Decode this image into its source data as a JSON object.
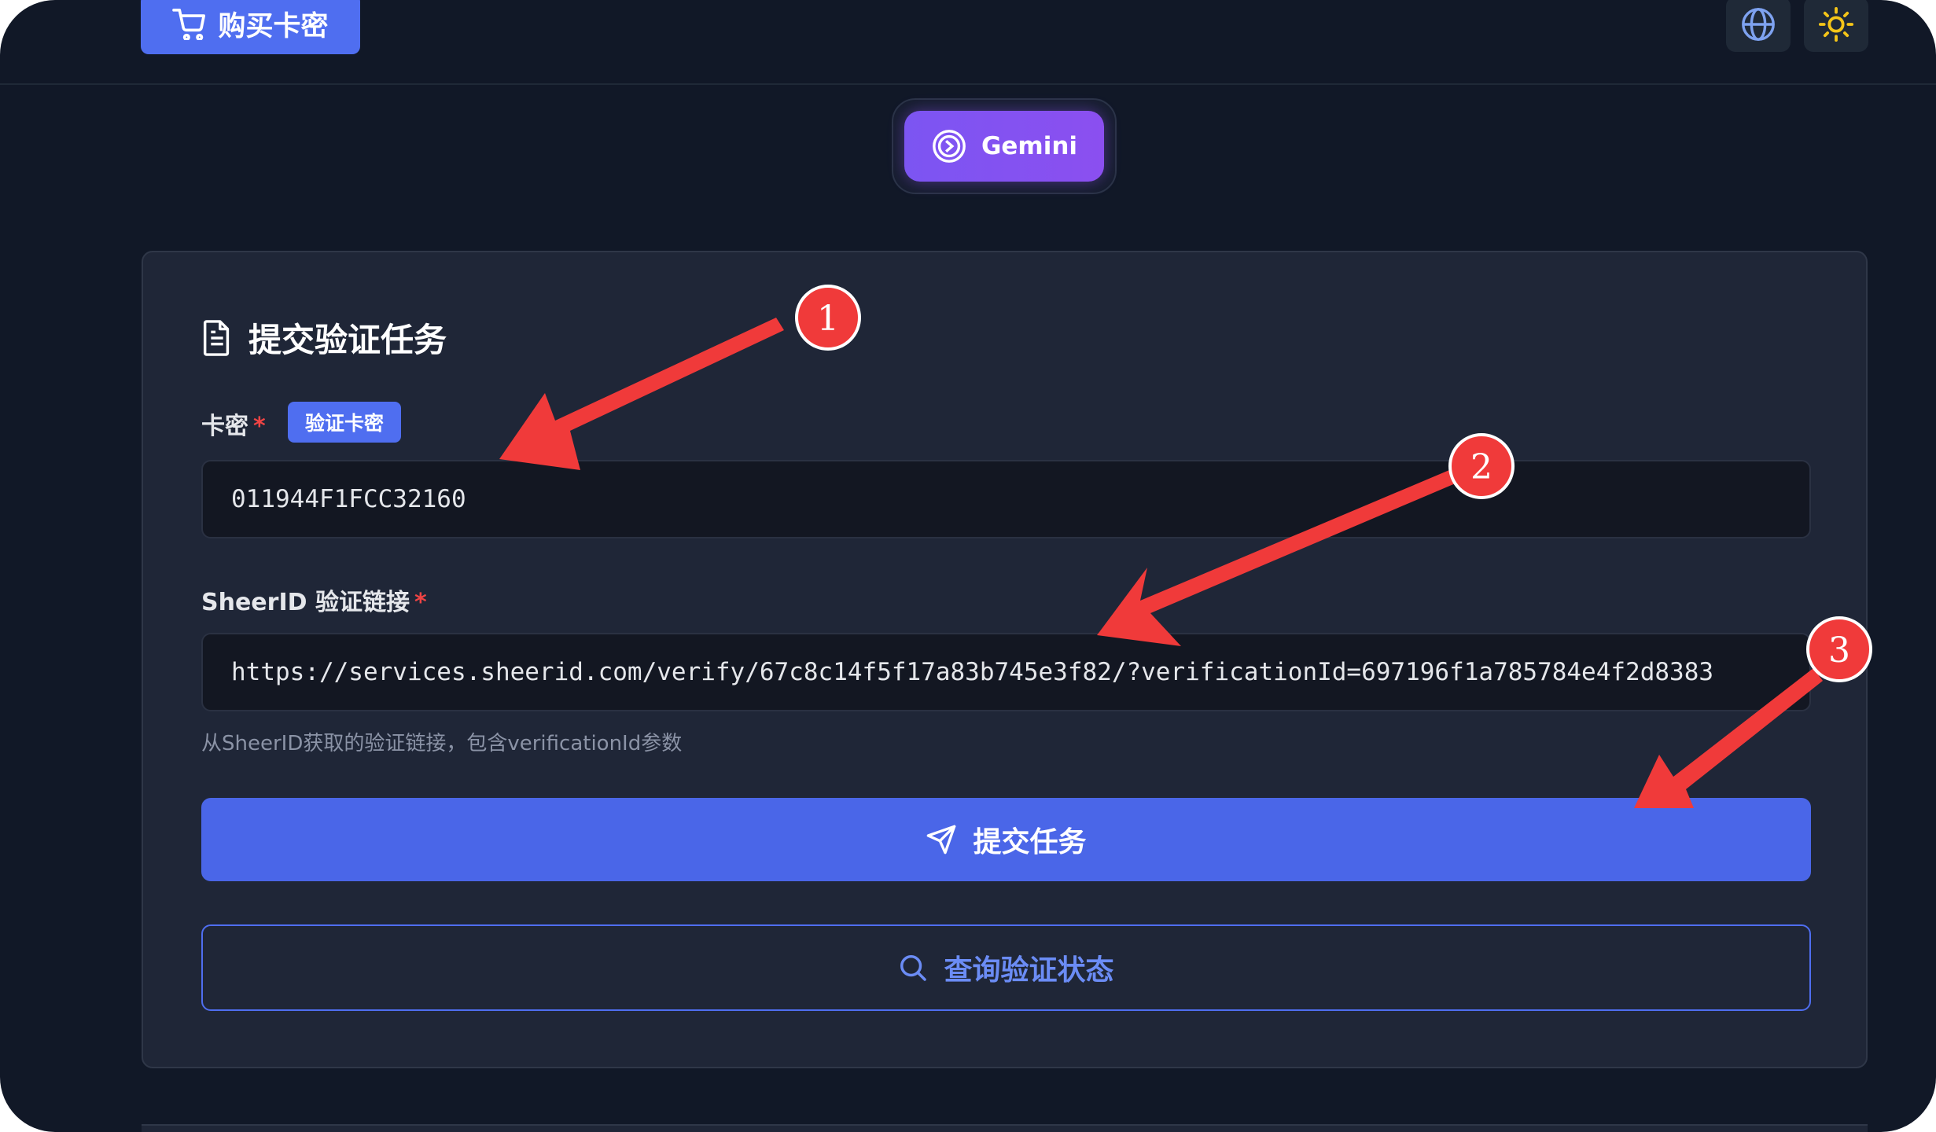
{
  "topbar": {
    "buy_button_label": "购买卡密",
    "language_icon": "globe-icon",
    "theme_icon": "sun-icon"
  },
  "tabs": {
    "active_label": "Gemini"
  },
  "form": {
    "title": "提交验证任务",
    "card_key_label": "卡密",
    "verify_card_badge": "验证卡密",
    "card_key_value": "011944F1FCC32160",
    "sheerid_label": "SheerID 验证链接",
    "sheerid_value": "https://services.sheerid.com/verify/67c8c14f5f17a83b745e3f82/?verificationId=697196f1a785784e4f2d8383",
    "sheerid_hint": "从SheerID获取的验证链接，包含verificationId参数",
    "required_mark": "*",
    "submit_label": "提交任务",
    "query_label": "查询验证状态"
  },
  "annotations": {
    "markers": [
      "1",
      "2",
      "3"
    ]
  },
  "colors": {
    "accent": "#4f6ef0",
    "gemini": "#7c55f2",
    "annotation_red": "#f03a3a",
    "background": "#111827",
    "card": "#1f2637"
  }
}
